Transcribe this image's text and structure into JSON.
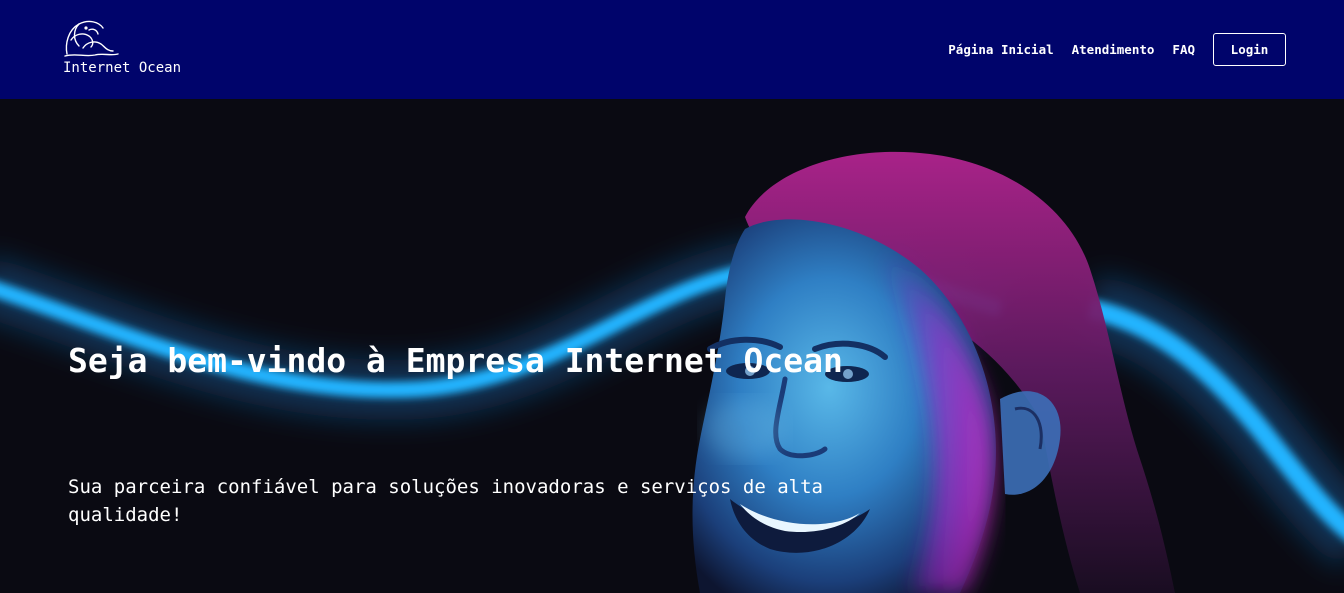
{
  "colors": {
    "navbar_bg": "#00046b",
    "hero_bg": "#0a0a12",
    "glow_accent": "#1ea8ff",
    "magenta_accent": "#c026d3",
    "text": "#ffffff"
  },
  "brand": {
    "logo_icon": "wave-icon",
    "name": "Internet Ocean"
  },
  "nav": {
    "items": [
      {
        "label": "Página Inicial"
      },
      {
        "label": "Atendimento"
      },
      {
        "label": "FAQ"
      }
    ],
    "login_label": "Login"
  },
  "hero": {
    "title": "Seja bem-vindo à Empresa Internet Ocean",
    "subtitle": "Sua parceira confiável para soluções inovadoras e serviços de alta qualidade!",
    "image_icon": "smiling-man-neon-photo"
  }
}
